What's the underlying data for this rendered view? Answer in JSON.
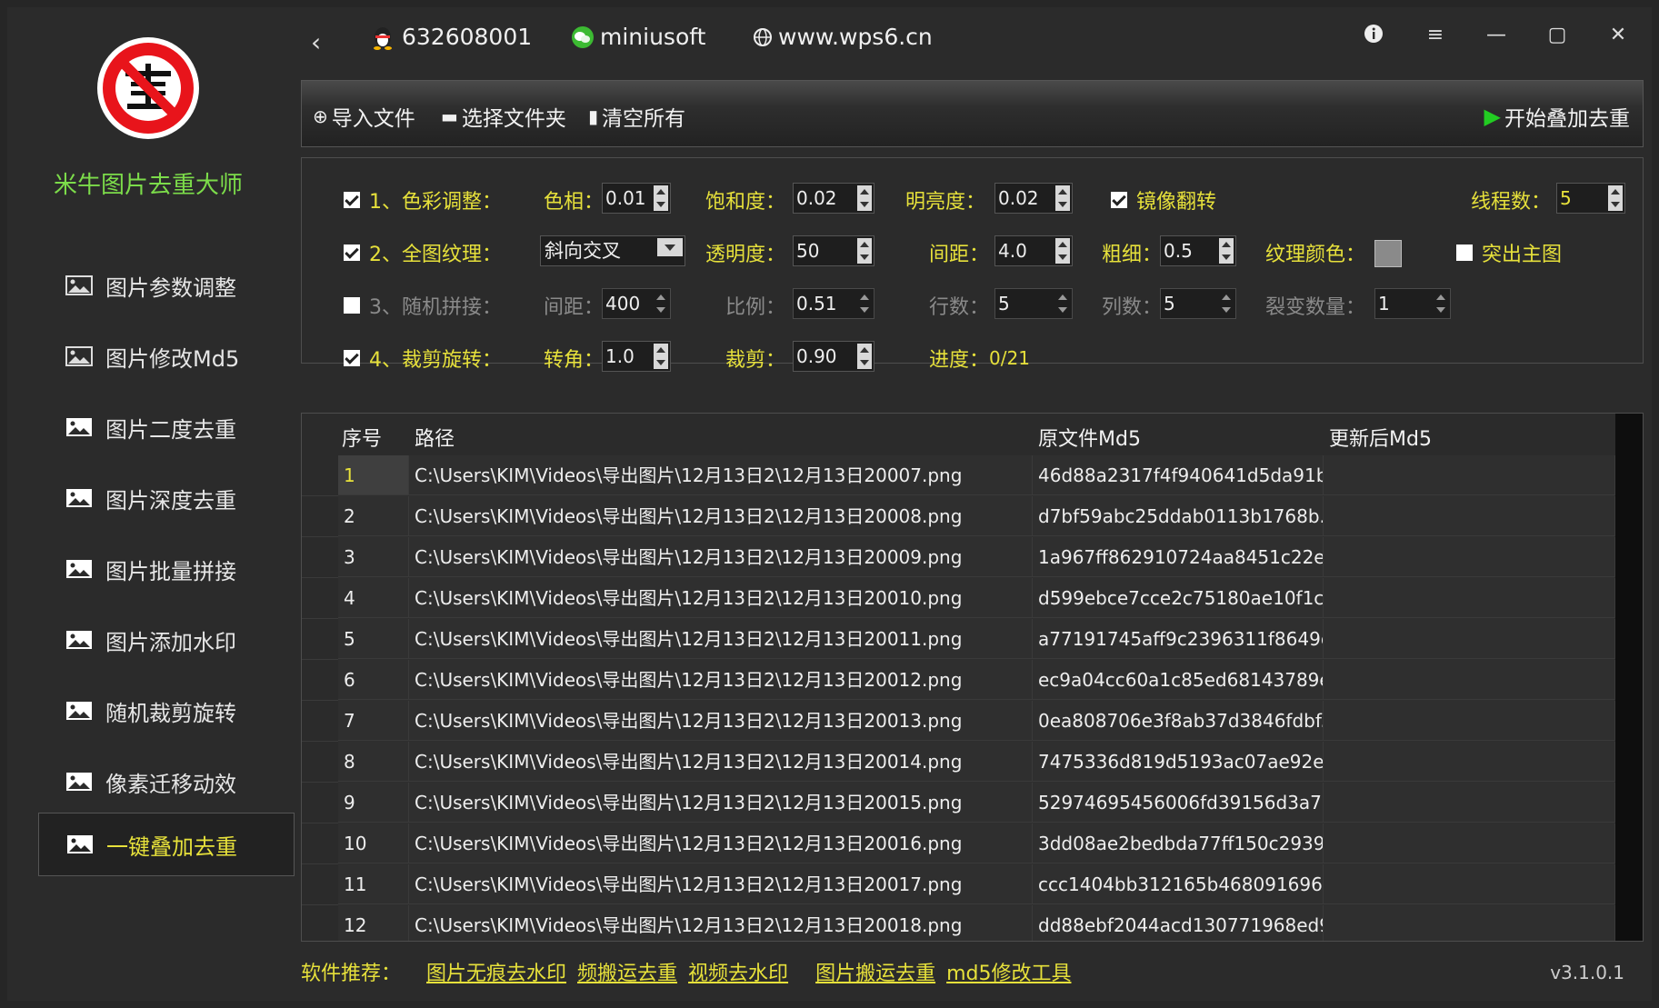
{
  "app": {
    "name": "米牛图片去重大师",
    "version": "v3.1.0.1"
  },
  "topbar": {
    "qq": "632608001",
    "wechat": "miniusoft",
    "website": "www.wps6.cn"
  },
  "sidebar": {
    "items": [
      {
        "label": "图片参数调整"
      },
      {
        "label": "图片修改Md5"
      },
      {
        "label": "图片二度去重"
      },
      {
        "label": "图片深度去重"
      },
      {
        "label": "图片批量拼接"
      },
      {
        "label": "图片添加水印"
      },
      {
        "label": "随机裁剪旋转"
      },
      {
        "label": "像素迁移动效"
      },
      {
        "label": "一键叠加去重"
      }
    ]
  },
  "toolbar": {
    "import": "导入文件",
    "folder": "选择文件夹",
    "clear": "清空所有",
    "start": "开始叠加去重"
  },
  "options": {
    "color": {
      "label": "1、色彩调整：",
      "hue_label": "色相：",
      "hue": "0.01",
      "sat_label": "饱和度：",
      "sat": "0.02",
      "bright_label": "明亮度：",
      "bright": "0.02",
      "mirror_label": "镜像翻转",
      "threads_label": "线程数：",
      "threads": "5"
    },
    "texture": {
      "label": "2、全图纹理：",
      "pattern": "斜向交叉",
      "opacity_label": "透明度：",
      "opacity": "50",
      "spacing_label": "间距：",
      "spacing": "4.0",
      "thickness_label": "粗细：",
      "thickness": "0.5",
      "color_label": "纹理颜色：",
      "highlight_label": "突出主图",
      "texture_color": "#8a8a8a"
    },
    "stitch": {
      "label": "3、随机拼接：",
      "spacing_label": "间距：",
      "spacing": "400",
      "ratio_label": "比例：",
      "ratio": "0.51",
      "rows_label": "行数：",
      "rows": "5",
      "cols_label": "列数：",
      "cols": "5",
      "split_label": "裂变数量：",
      "split": "1"
    },
    "crop": {
      "label": "4、裁剪旋转：",
      "angle_label": "转角：",
      "angle": "1.0",
      "crop_label": "裁剪：",
      "crop": "0.90",
      "progress_label": "进度：",
      "progress": "0/21"
    }
  },
  "table": {
    "headers": {
      "index": "序号",
      "path": "路径",
      "md5_orig": "原文件Md5",
      "md5_new": "更新后Md5"
    },
    "rows": [
      {
        "i": "1",
        "path": "C:\\Users\\KIM\\Videos\\导出图片\\12月13日2\\12月13日20007.png",
        "md5": "46d88a2317f4f940641d5da91b...",
        "new": ""
      },
      {
        "i": "2",
        "path": "C:\\Users\\KIM\\Videos\\导出图片\\12月13日2\\12月13日20008.png",
        "md5": "d7bf59abc25ddab0113b1768b...",
        "new": ""
      },
      {
        "i": "3",
        "path": "C:\\Users\\KIM\\Videos\\导出图片\\12月13日2\\12月13日20009.png",
        "md5": "1a967ff862910724aa8451c22e...",
        "new": ""
      },
      {
        "i": "4",
        "path": "C:\\Users\\KIM\\Videos\\导出图片\\12月13日2\\12月13日20010.png",
        "md5": "d599ebce7cce2c75180ae10f1c...",
        "new": ""
      },
      {
        "i": "5",
        "path": "C:\\Users\\KIM\\Videos\\导出图片\\12月13日2\\12月13日20011.png",
        "md5": "a77191745aff9c2396311f8649c...",
        "new": ""
      },
      {
        "i": "6",
        "path": "C:\\Users\\KIM\\Videos\\导出图片\\12月13日2\\12月13日20012.png",
        "md5": "ec9a04cc60a1c85ed68143789e...",
        "new": ""
      },
      {
        "i": "7",
        "path": "C:\\Users\\KIM\\Videos\\导出图片\\12月13日2\\12月13日20013.png",
        "md5": "0ea808706e3f8ab37d3846fdbf...",
        "new": ""
      },
      {
        "i": "8",
        "path": "C:\\Users\\KIM\\Videos\\导出图片\\12月13日2\\12月13日20014.png",
        "md5": "7475336d819d5193ac07ae92e...",
        "new": ""
      },
      {
        "i": "9",
        "path": "C:\\Users\\KIM\\Videos\\导出图片\\12月13日2\\12月13日20015.png",
        "md5": "52974695456006fd39156d3a77...",
        "new": ""
      },
      {
        "i": "10",
        "path": "C:\\Users\\KIM\\Videos\\导出图片\\12月13日2\\12月13日20016.png",
        "md5": "3dd08ae2bedbda77ff150c2939...",
        "new": ""
      },
      {
        "i": "11",
        "path": "C:\\Users\\KIM\\Videos\\导出图片\\12月13日2\\12月13日20017.png",
        "md5": "ccc1404bb312165b4680916969...",
        "new": ""
      },
      {
        "i": "12",
        "path": "C:\\Users\\KIM\\Videos\\导出图片\\12月13日2\\12月13日20018.png",
        "md5": "dd88ebf2044acd130771968ed9...",
        "new": ""
      }
    ]
  },
  "footer": {
    "label": "软件推荐：",
    "links": [
      "图片无痕去水印",
      "频搬运去重",
      "视频去水印",
      "图片搬运去重",
      "md5修改工具"
    ]
  },
  "colors": {
    "accent_yellow": "#e7e13b",
    "app_name_green": "#7cdc4a",
    "start_green": "#22cc22"
  }
}
